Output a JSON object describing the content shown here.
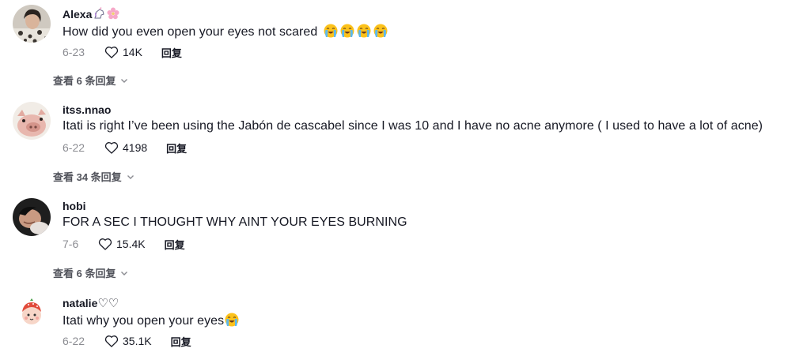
{
  "comments": [
    {
      "username": "Alexa",
      "username_emojis": [
        "unicorn-emoji",
        "cherry-blossom-emoji"
      ],
      "text": "How did you even open your eyes not scared",
      "text_emojis": [
        "loudly-crying-emoji",
        "loudly-crying-emoji",
        "loudly-crying-emoji",
        "loudly-crying-emoji"
      ],
      "date": "6-23",
      "likes": "14K",
      "reply_label": "回复",
      "view_replies": "查看 6 条回复"
    },
    {
      "username": "itss.nnao",
      "text": "Itati is right I’ve been using the Jabón de cascabel since I was 10 and I have no acne anymore ( I used to have a lot of acne)",
      "date": "6-22",
      "likes": "4198",
      "reply_label": "回复",
      "view_replies": "查看 34 条回复"
    },
    {
      "username": "hobi",
      "text": "FOR A SEC I THOUGHT WHY AINT YOUR EYES BURNING",
      "date": "7-6",
      "likes": "15.4K",
      "reply_label": "回复",
      "view_replies": "查看 6 条回复"
    },
    {
      "username": "natalie",
      "username_suffix": "♡♡",
      "text": "Itati why you open your eyes",
      "text_emojis": [
        "loudly-crying-emoji"
      ],
      "date": "6-22",
      "likes": "35.1K",
      "reply_label": "回复"
    }
  ],
  "icons": {
    "like": "heart-outline-icon",
    "expand": "chevron-down-icon"
  },
  "colors": {
    "text_primary": "#161823",
    "text_secondary": "#8a8b91"
  }
}
